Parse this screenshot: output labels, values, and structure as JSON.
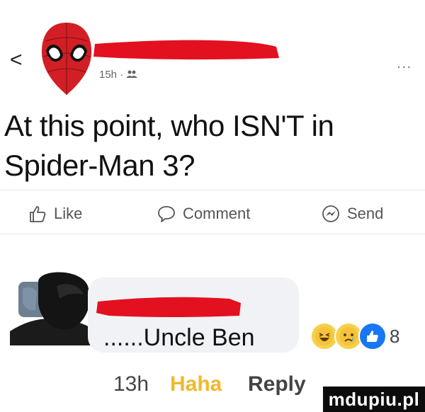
{
  "header": {
    "back_glyph": "<",
    "time": "15h",
    "separator": "·",
    "audience_icon": "friends-icon",
    "more_glyph": "..."
  },
  "post": {
    "line1": "At this point, who ISN'T in",
    "line2": "Spider-Man 3?"
  },
  "actions": {
    "like": "Like",
    "comment": "Comment",
    "send": "Send"
  },
  "comment": {
    "text": "......Uncle Ben",
    "reaction_count": "8",
    "time": "13h",
    "haha": "Haha",
    "reply": "Reply"
  },
  "watermark": "mdupiu.pl",
  "colors": {
    "redaction": "#e3101f",
    "haha_active": "#f0b82c",
    "muted": "#666666",
    "bubble": "#f0f2f5"
  }
}
